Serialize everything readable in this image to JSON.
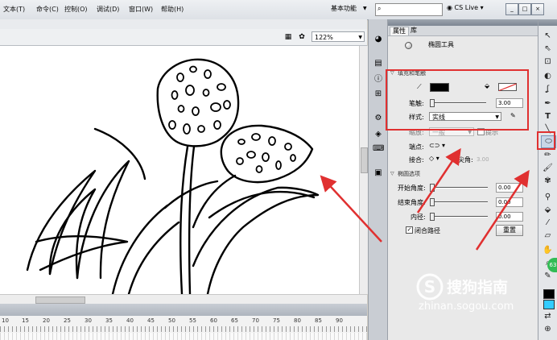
{
  "menu": [
    "文本(T)",
    "命令(C)",
    "控制(O)",
    "调试(D)",
    "窗口(W)",
    "帮助(H)"
  ],
  "workspace": {
    "label": "基本功能"
  },
  "search": {
    "placeholder": ""
  },
  "cs_live": "CS Live",
  "window_buttons": [
    "_",
    "□",
    "×"
  ],
  "zoom": {
    "value": "122%"
  },
  "panel": {
    "tabs": [
      "属性",
      "库"
    ],
    "tool_name": "椭圆工具",
    "fill_stroke": {
      "title": "填充和笔触",
      "stroke_label": "笔触:",
      "stroke_value": "3.00",
      "style_label": "样式:",
      "style_value": "实线",
      "scale_label": "缩放:",
      "scale_value": "一般",
      "hint_label": "提示",
      "cap_label": "端点:",
      "join_label": "接合:",
      "miter_label": "尖角:",
      "miter_value": "3.00",
      "stroke_color": "#000000",
      "fill_color": "none"
    },
    "ellipse": {
      "title": "椭圆选项",
      "start_label": "开始角度:",
      "start_value": "0.00",
      "end_label": "结束角度:",
      "end_value": "0.00",
      "inner_label": "内径:",
      "inner_value": "0.00",
      "close_label": "闭合路径",
      "reset_label": "重置"
    }
  },
  "ruler_numbers": [
    "10",
    "15",
    "20",
    "25",
    "30",
    "35",
    "40",
    "45",
    "50",
    "55",
    "60",
    "65",
    "70",
    "75",
    "80",
    "85",
    "90"
  ],
  "watermark": {
    "brand": "搜狗指南",
    "url": "zhinan.sogou.com"
  },
  "badge": "63",
  "colors": {
    "annotation": "#e03030",
    "fill_swatch": "#33ccff"
  }
}
